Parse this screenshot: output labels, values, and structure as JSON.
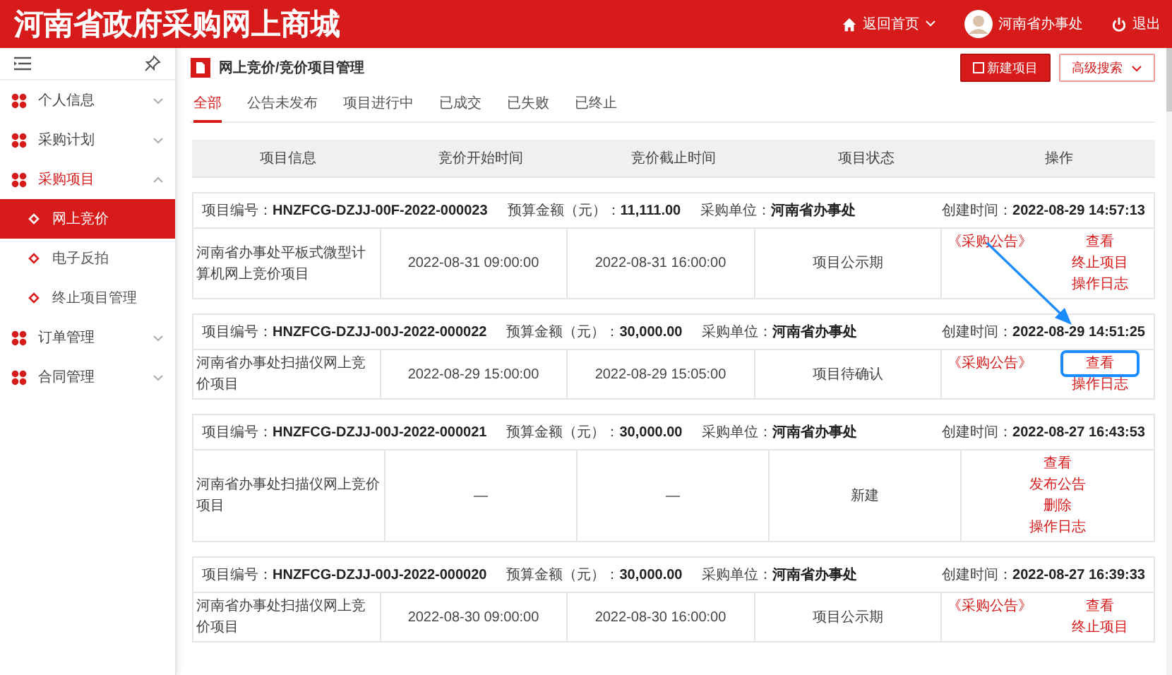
{
  "header": {
    "title": "河南省政府采购网上商城",
    "home_link": "返回首页",
    "user": "河南省办事处",
    "logout": "退出"
  },
  "sidebar": {
    "items": [
      {
        "label": "个人信息",
        "expanded": false
      },
      {
        "label": "采购计划",
        "expanded": false
      },
      {
        "label": "采购项目",
        "expanded": true,
        "children": [
          {
            "label": "网上竞价",
            "selected": true
          },
          {
            "label": "电子反拍",
            "selected": false
          },
          {
            "label": "终止项目管理",
            "selected": false
          }
        ]
      },
      {
        "label": "订单管理",
        "expanded": false
      },
      {
        "label": "合同管理",
        "expanded": false
      }
    ]
  },
  "page": {
    "title": "网上竞价/竞价项目管理",
    "new_button": "新建项目",
    "search_button": "高级搜索"
  },
  "tabs": [
    {
      "label": "全部",
      "selected": true
    },
    {
      "label": "公告未发布",
      "selected": false
    },
    {
      "label": "项目进行中",
      "selected": false
    },
    {
      "label": "已成交",
      "selected": false
    },
    {
      "label": "已失败",
      "selected": false
    },
    {
      "label": "已终止",
      "selected": false
    }
  ],
  "table": {
    "columns": [
      "项目信息",
      "竞价开始时间",
      "竞价截止时间",
      "项目状态",
      "操作"
    ],
    "records": [
      {
        "number_label": "项目编号：",
        "number": "HNZFCG-DZJJ-00F-2022-000023",
        "budget_label": "预算金额（元）：",
        "budget": "11,111.00",
        "buyer_label": "采购单位：",
        "buyer": "河南省办事处",
        "created_label": "创建时间：",
        "created": "2022-08-29 14:57:13",
        "name": "河南省办事处平板式微型计算机网上竞价项目",
        "start": "2022-08-31 09:00:00",
        "end": "2022-08-31 16:00:00",
        "status": "项目公示期",
        "notice": "《采购公告》",
        "actions": [
          {
            "label": "查看",
            "highlighted": false
          },
          {
            "label": "终止项目",
            "highlighted": false
          },
          {
            "label": "操作日志",
            "highlighted": false
          }
        ]
      },
      {
        "number_label": "项目编号：",
        "number": "HNZFCG-DZJJ-00J-2022-000022",
        "budget_label": "预算金额（元）：",
        "budget": "30,000.00",
        "buyer_label": "采购单位：",
        "buyer": "河南省办事处",
        "created_label": "创建时间：",
        "created": "2022-08-29 14:51:25",
        "name": "河南省办事处扫描仪网上竞价项目",
        "start": "2022-08-29 15:00:00",
        "end": "2022-08-29 15:05:00",
        "status": "项目待确认",
        "notice": "《采购公告》",
        "actions": [
          {
            "label": "查看",
            "highlighted": true
          },
          {
            "label": "操作日志",
            "highlighted": false
          }
        ]
      },
      {
        "number_label": "项目编号：",
        "number": "HNZFCG-DZJJ-00J-2022-000021",
        "budget_label": "预算金额（元）：",
        "budget": "30,000.00",
        "buyer_label": "采购单位：",
        "buyer": "河南省办事处",
        "created_label": "创建时间：",
        "created": "2022-08-27 16:43:53",
        "name": "河南省办事处扫描仪网上竞价项目",
        "start": "—",
        "end": "—",
        "status": "新建",
        "actions": [
          {
            "label": "查看",
            "highlighted": false
          },
          {
            "label": "发布公告",
            "highlighted": false
          },
          {
            "label": "删除",
            "highlighted": false
          },
          {
            "label": "操作日志",
            "highlighted": false
          }
        ]
      },
      {
        "number_label": "项目编号：",
        "number": "HNZFCG-DZJJ-00J-2022-000020",
        "budget_label": "预算金额（元）：",
        "budget": "30,000.00",
        "buyer_label": "采购单位：",
        "buyer": "河南省办事处",
        "created_label": "创建时间：",
        "created": "2022-08-27 16:39:33",
        "name": "河南省办事处扫描仪网上竞价项目",
        "start": "2022-08-30 09:00:00",
        "end": "2022-08-30 16:00:00",
        "status": "项目公示期",
        "notice": "《采购公告》",
        "actions": [
          {
            "label": "查看",
            "highlighted": false
          },
          {
            "label": "终止项目",
            "highlighted": false
          }
        ]
      }
    ]
  }
}
